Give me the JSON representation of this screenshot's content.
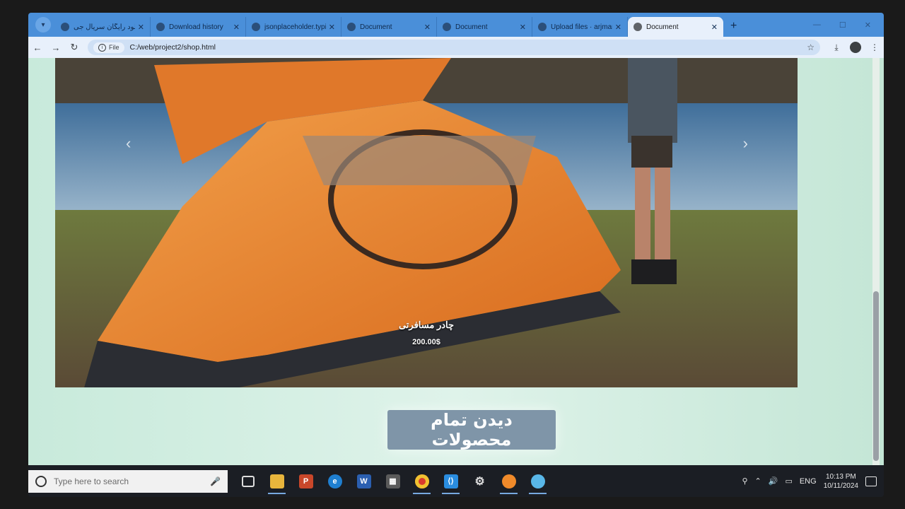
{
  "browser": {
    "tabs": [
      {
        "title": "دانلود رایگان سریال جی",
        "active": false
      },
      {
        "title": "Download history",
        "active": false
      },
      {
        "title": "jsonplaceholder.typic",
        "active": false
      },
      {
        "title": "Document",
        "active": false
      },
      {
        "title": "Document",
        "active": false
      },
      {
        "title": "Upload files · arjman",
        "active": false
      },
      {
        "title": "Document",
        "active": true
      }
    ],
    "new_tab_icon": "+",
    "file_chip": "File",
    "url": "C:/web/project2/shop.html"
  },
  "hero": {
    "product_name": "چادر مسافرتی",
    "price": "200.00$",
    "prev_arrow": "‹",
    "next_arrow": "›"
  },
  "cta": {
    "label": "دیدن تمام محصولات"
  },
  "taskbar": {
    "search_placeholder": "Type here to search",
    "language": "ENG",
    "time": "10:13 PM",
    "date": "10/11/2024"
  }
}
